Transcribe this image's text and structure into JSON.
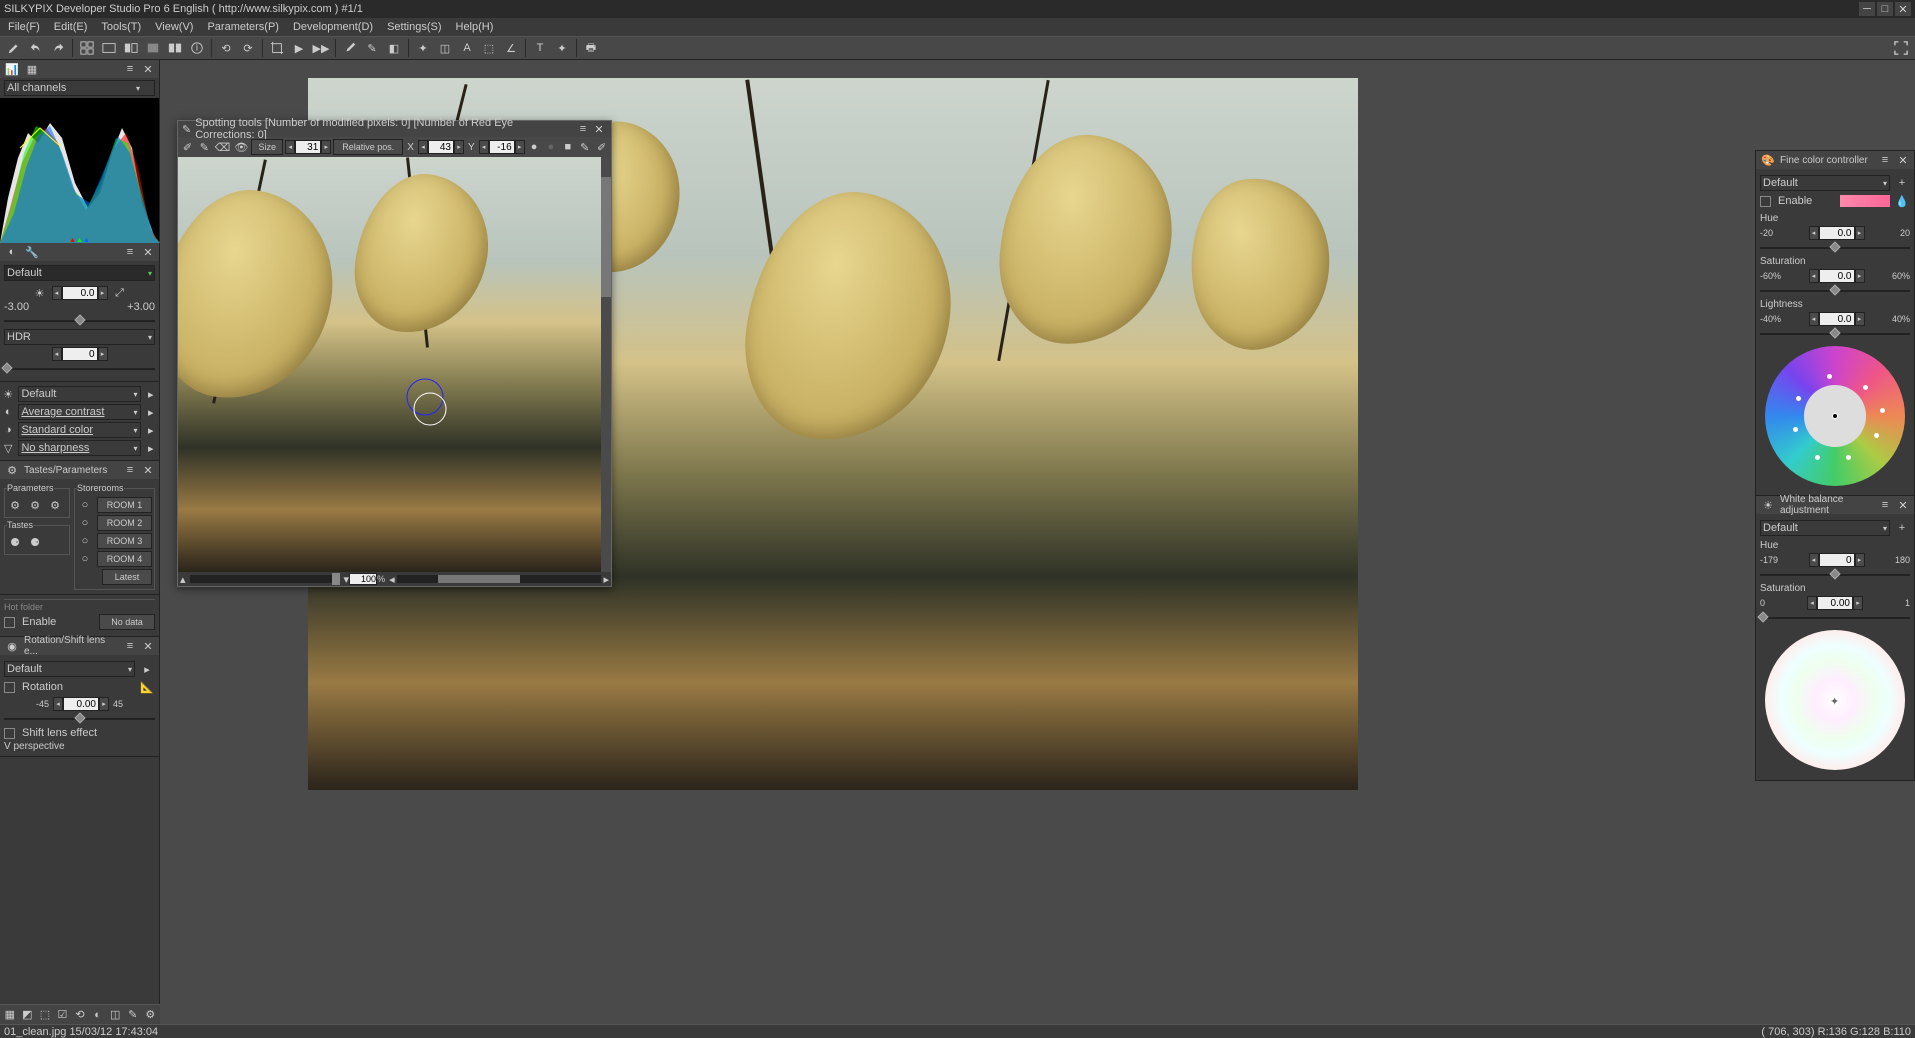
{
  "titlebar": {
    "title": "SILKYPIX Developer Studio Pro 6 English ( http://www.silkypix.com )   #1/1"
  },
  "menu": [
    "File(F)",
    "Edit(E)",
    "Tools(T)",
    "View(V)",
    "Parameters(P)",
    "Development(D)",
    "Settings(S)",
    "Help(H)"
  ],
  "histogram": {
    "channel_label": "All channels"
  },
  "exposure": {
    "bias_value": "0.0",
    "bias_min": "-3.00",
    "bias_max": "+3.00",
    "hdr_label": "HDR",
    "hdr_value": "0"
  },
  "basic": {
    "default": "Default",
    "contrast": "Average contrast",
    "color": "Standard color",
    "sharp": "No sharpness"
  },
  "tastes": {
    "title": "Tastes/Parameters",
    "param_label": "Parameters",
    "store_label": "Storerooms",
    "tastes_label": "Tastes",
    "rooms": [
      "ROOM 1",
      "ROOM 2",
      "ROOM 3",
      "ROOM 4"
    ],
    "latest": "Latest"
  },
  "hot": {
    "title": "Hot folder",
    "enable": "Enable",
    "nodata": "No data"
  },
  "rotation": {
    "title": "Rotation/Shift lens e...",
    "default": "Default",
    "rotation_chk": "Rotation",
    "angle": "0.00",
    "angle_min": "-45",
    "angle_max": "45",
    "shift_chk": "Shift lens effect",
    "persp": "V perspective"
  },
  "spot": {
    "title": "Spotting tools [Number of modified pixels: 0]  [Number of Red Eye Corrections: 0]",
    "size_lbl": "Size",
    "size_val": "31",
    "relpos": "Relative pos.",
    "x_lbl": "X",
    "x_val": "43",
    "y_lbl": "Y",
    "y_val": "-16",
    "zoom": "100"
  },
  "finecolor": {
    "title": "Fine color controller",
    "preset": "Default",
    "enable": "Enable",
    "hue_lbl": "Hue",
    "hue_val": "0.0",
    "hue_min": "-20",
    "hue_max": "20",
    "sat_lbl": "Saturation",
    "sat_val": "0.0",
    "sat_min": "-60%",
    "sat_max": "60%",
    "light_lbl": "Lightness",
    "light_val": "0.0",
    "light_min": "-40%",
    "light_max": "40%"
  },
  "wb": {
    "title": "White balance adjustment",
    "preset": "Default",
    "hue_lbl": "Hue",
    "hue_val": "0",
    "hue_min": "-179",
    "hue_max": "180",
    "sat_lbl": "Saturation",
    "sat_val": "0.00",
    "sat_min": "0",
    "sat_max": "1"
  },
  "status": {
    "file": "01_clean.jpg 15/03/12 17:43:04",
    "coords": "( 706, 303) R:136 G:128 B:110"
  },
  "zoom_pct": "%"
}
